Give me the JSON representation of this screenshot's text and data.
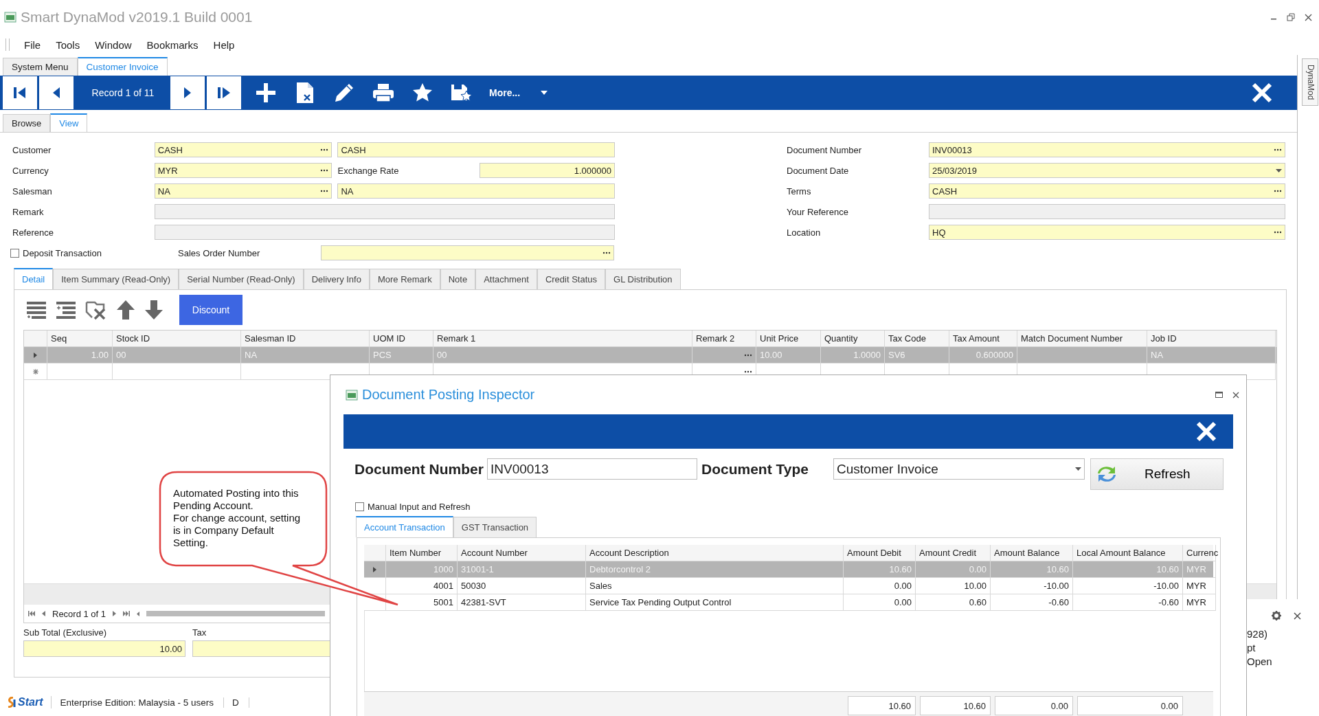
{
  "app": {
    "title": "Smart DynaMod v2019.1 Build 0001"
  },
  "menu": [
    "File",
    "Tools",
    "Window",
    "Bookmarks",
    "Help"
  ],
  "module_tabs": [
    {
      "label": "System Menu",
      "selected": false
    },
    {
      "label": "Customer Invoice",
      "selected": true
    }
  ],
  "side_tab": "DynaMod",
  "toolbar": {
    "record": "Record 1 of 11",
    "more": "More..."
  },
  "view_tabs": [
    {
      "label": "Browse",
      "selected": false
    },
    {
      "label": "View",
      "selected": true
    }
  ],
  "form_left": [
    {
      "label": "Customer",
      "kind": "lookup_pair",
      "value": "CASH",
      "value2": "CASH"
    },
    {
      "label": "Currency",
      "kind": "lookup_rate",
      "value": "MYR",
      "label2": "Exchange Rate",
      "value2": "1.000000"
    },
    {
      "label": "Salesman",
      "kind": "lookup_pair",
      "value": "NA",
      "value2": "NA"
    },
    {
      "label": "Remark",
      "kind": "text"
    },
    {
      "label": "Reference",
      "kind": "text"
    }
  ],
  "deposit": {
    "label": "Deposit Transaction",
    "checked": false
  },
  "sales_order": {
    "label": "Sales Order Number"
  },
  "form_right": [
    {
      "label": "Document Number",
      "kind": "lookup",
      "value": "INV00013"
    },
    {
      "label": "Document Date",
      "kind": "date",
      "value": "25/03/2019"
    },
    {
      "label": "Terms",
      "kind": "lookup",
      "value": "CASH"
    },
    {
      "label": "Your Reference",
      "kind": "text"
    },
    {
      "label": "Location",
      "kind": "lookup",
      "value": "HQ"
    }
  ],
  "detail_tabs": [
    {
      "label": "Detail",
      "selected": true
    },
    {
      "label": "Item Summary (Read-Only)",
      "selected": false
    },
    {
      "label": "Serial Number (Read-Only)",
      "selected": false
    },
    {
      "label": "Delivery Info",
      "selected": false
    },
    {
      "label": "More Remark",
      "selected": false
    },
    {
      "label": "Note",
      "selected": false
    },
    {
      "label": "Attachment",
      "selected": false
    },
    {
      "label": "Credit Status",
      "selected": false
    },
    {
      "label": "GL Distribution",
      "selected": false
    }
  ],
  "detail_toolbar": {
    "discount": "Discount"
  },
  "items_grid": {
    "columns": [
      {
        "label": "Seq",
        "kind": "number"
      },
      {
        "label": "Stock ID",
        "kind": "text"
      },
      {
        "label": "Salesman ID",
        "kind": "text"
      },
      {
        "label": "UOM ID",
        "kind": "text"
      },
      {
        "label": "Remark 1",
        "kind": "text"
      },
      {
        "label": "Remark 2",
        "kind": "lookup"
      },
      {
        "label": "Unit Price",
        "kind": "text"
      },
      {
        "label": "Quantity",
        "kind": "number"
      },
      {
        "label": "Tax Code",
        "kind": "text"
      },
      {
        "label": "Tax Amount",
        "kind": "number"
      },
      {
        "label": "Match Document Number",
        "kind": "text"
      },
      {
        "label": "Job ID",
        "kind": "text"
      }
    ],
    "rows": [
      {
        "selected": true,
        "cells": [
          "1.00",
          "00",
          "NA",
          "PCS",
          "00",
          null,
          "10.00",
          "1.0000",
          "SV6",
          "0.600000",
          null,
          "NA"
        ]
      }
    ],
    "new_row": true,
    "record": "Record 1 of 1"
  },
  "totals": [
    {
      "label": "Sub Total (Exclusive)",
      "value": "10.00"
    },
    {
      "label": "Tax"
    }
  ],
  "status_bar": {
    "start": "Start",
    "edition": "Enterprise Edition: Malaysia - 5 users",
    "pane_2": "D"
  },
  "dialog": {
    "title": "Document Posting Inspector",
    "doc_number_label": "Document Number",
    "doc_number": "INV00013",
    "doc_type_label": "Document Type",
    "doc_type": "Customer Invoice",
    "refresh": "Refresh",
    "manual": {
      "label": "Manual Input and Refresh",
      "checked": false
    },
    "tabs": [
      {
        "label": "Account Transaction",
        "selected": true
      },
      {
        "label": "GST Transaction",
        "selected": false
      }
    ],
    "columns": [
      {
        "label": "Item Number",
        "kind": "number"
      },
      {
        "label": "Account Number",
        "kind": "text"
      },
      {
        "label": "Account Description",
        "kind": "text"
      },
      {
        "label": "Amount Debit",
        "kind": "number"
      },
      {
        "label": "Amount Credit",
        "kind": "number"
      },
      {
        "label": "Amount Balance",
        "kind": "number"
      },
      {
        "label": "Local Amount Balance",
        "kind": "number"
      },
      {
        "label": "Currenc",
        "kind": "text"
      }
    ],
    "rows": [
      {
        "selected": true,
        "cells": [
          "1000",
          "31001-1",
          "Debtorcontrol 2",
          "10.60",
          "0.00",
          "10.60",
          "10.60",
          "MYR"
        ]
      },
      {
        "selected": false,
        "cells": [
          "4001",
          "50030",
          "Sales",
          "0.00",
          "10.00",
          "-10.00",
          "-10.00",
          "MYR"
        ]
      },
      {
        "selected": false,
        "cells": [
          "5001",
          "42381-SVT",
          "Service Tax Pending Output Control",
          "0.00",
          "0.60",
          "-0.60",
          "-0.60",
          "MYR"
        ]
      }
    ],
    "totals": [
      "10.60",
      "10.60",
      "0.00",
      "0.00"
    ]
  },
  "callout": {
    "text": "Automated Posting into this\nPending Account.\nFor change account, setting\nis in Company Default\nSetting."
  },
  "side_panel": {
    "lines": [
      "928)",
      "pt",
      "Open"
    ]
  }
}
